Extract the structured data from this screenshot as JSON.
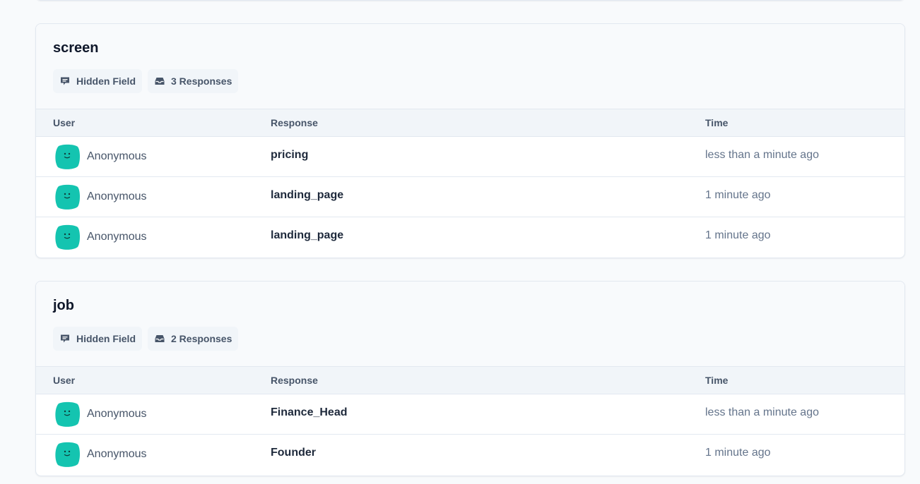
{
  "questions": [
    {
      "title": "screen",
      "type_badge": "Hidden Field",
      "responses_badge": "3 Responses",
      "headers": {
        "user": "User",
        "response": "Response",
        "time": "Time"
      },
      "rows": [
        {
          "user": "Anonymous",
          "response": "pricing",
          "time": "less than a minute ago"
        },
        {
          "user": "Anonymous",
          "response": "landing_page",
          "time": "1 minute ago"
        },
        {
          "user": "Anonymous",
          "response": "landing_page",
          "time": "1 minute ago"
        }
      ]
    },
    {
      "title": "job",
      "type_badge": "Hidden Field",
      "responses_badge": "2 Responses",
      "headers": {
        "user": "User",
        "response": "Response",
        "time": "Time"
      },
      "rows": [
        {
          "user": "Anonymous",
          "response": "Finance_Head",
          "time": "less than a minute ago"
        },
        {
          "user": "Anonymous",
          "response": "Founder",
          "time": "1 minute ago"
        }
      ]
    }
  ],
  "colors": {
    "avatar": "#14c4b0",
    "accent_text": "#1e293b",
    "muted_text": "#64748b"
  },
  "icons": {
    "type_badge": "message-icon",
    "responses_badge": "inbox-icon",
    "avatar": "smiley-avatar-icon"
  }
}
